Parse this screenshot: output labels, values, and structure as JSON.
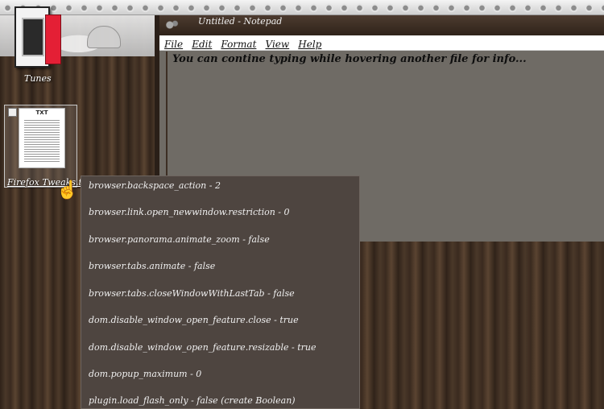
{
  "desktop": {
    "icons": [
      {
        "label": "Tunes"
      },
      {
        "label": "Firefox Tweaks.txt",
        "badge": "TXT"
      }
    ]
  },
  "notepad": {
    "title": "Untitled - Notepad",
    "menu": [
      "File",
      "Edit",
      "Format",
      "View",
      "Help"
    ],
    "content": "You can contine typing while hovering another file for info..."
  },
  "tooltip": {
    "rows": [
      "browser.backspace_action - 2",
      "browser.link.open_newwindow.restriction - 0",
      "browser.panorama.animate_zoom - false",
      "browser.tabs.animate - false",
      "browser.tabs.closeWindowWithLastTab - false",
      "dom.disable_window_open_feature.close - true",
      "dom.disable_window_open_feature.resizable - true",
      "dom.popup_maximum - 0",
      "plugin.load_flash_only - false (create Boolean)"
    ]
  },
  "colors": {
    "notepad_bg": "#6f6b65",
    "tooltip_bg": "#4e4540",
    "accent_red": "#e41f35"
  }
}
